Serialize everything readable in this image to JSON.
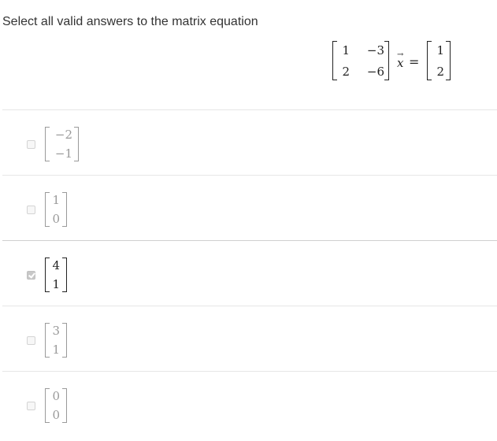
{
  "question": {
    "prompt": "Select all valid answers to the matrix equation"
  },
  "equation": {
    "matrix_a": [
      [
        "1",
        "−3"
      ],
      [
        "2",
        "−6"
      ]
    ],
    "variable": "x",
    "variable_arrow": "→",
    "equals": "=",
    "rhs": [
      "1",
      "2"
    ]
  },
  "options": [
    {
      "top": "−2",
      "bottom": "−1",
      "checked": false
    },
    {
      "top": "1",
      "bottom": "0",
      "checked": false
    },
    {
      "top": "4",
      "bottom": "1",
      "checked": true
    },
    {
      "top": "3",
      "bottom": "1",
      "checked": false
    },
    {
      "top": "0",
      "bottom": "0",
      "checked": false
    }
  ],
  "colors": {
    "text": "#333333",
    "faded_math": "#9a9a9a",
    "checked_box": "#c8c8c8",
    "divider": "#e6e6e6"
  }
}
